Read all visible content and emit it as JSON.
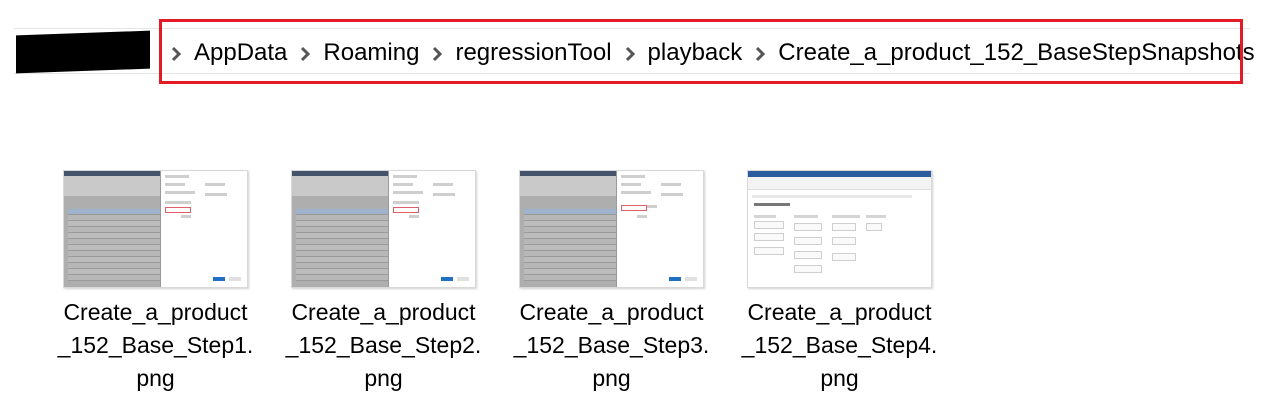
{
  "address_bar": {
    "crumbs": [
      "AppData",
      "Roaming",
      "regressionTool",
      "playback",
      "Create_a_product_152_BaseStepSnapshots"
    ],
    "separator_icon": "chevron-right-icon",
    "highlight_color": "#e21b26"
  },
  "files": [
    {
      "name_l1": "Create_a_product",
      "name_l2": "_152_Base_Step1.",
      "name_l3": "png",
      "thumb": "dialog"
    },
    {
      "name_l1": "Create_a_product",
      "name_l2": "_152_Base_Step2.",
      "name_l3": "png",
      "thumb": "dialog"
    },
    {
      "name_l1": "Create_a_product",
      "name_l2": "_152_Base_Step3.",
      "name_l3": "png",
      "thumb": "dialog"
    },
    {
      "name_l1": "Create_a_product",
      "name_l2": "_152_Base_Step4.",
      "name_l3": "png",
      "thumb": "form"
    }
  ]
}
